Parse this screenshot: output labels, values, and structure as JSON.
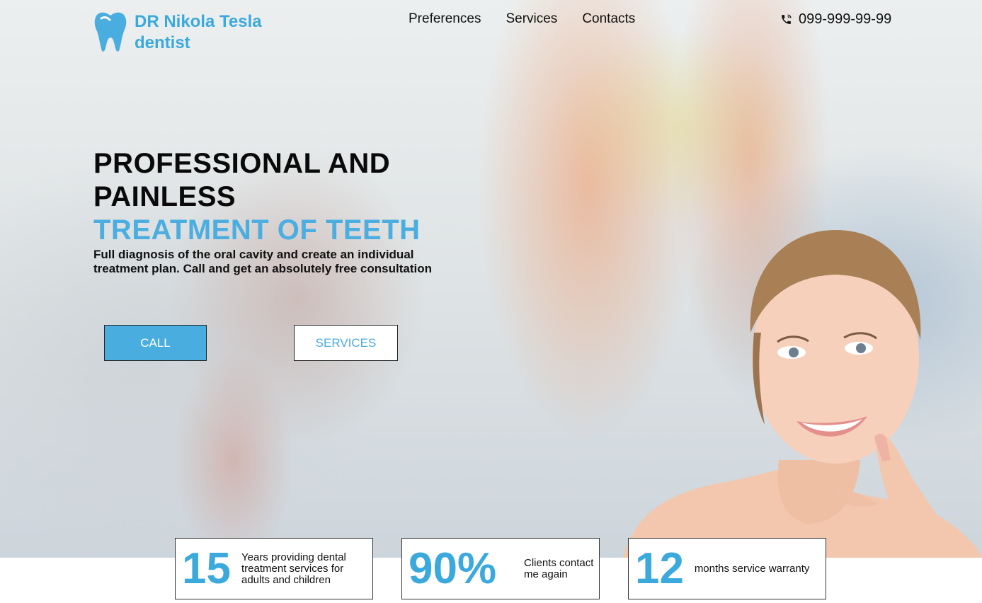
{
  "header": {
    "logo_line1": "DR Nikola Tesla",
    "logo_line2": "dentist",
    "nav": [
      "Preferences",
      "Services",
      "Contacts"
    ],
    "phone": "099-999-99-99"
  },
  "hero": {
    "headline": [
      "PROFESSIONAL AND",
      "PAINLESS"
    ],
    "headline_accent": "TREATMENT OF TEETH",
    "subtitle": "Full diagnosis of the oral cavity and create an individual treatment plan. Call and get an absolutely free consultation",
    "call_button": "CALL",
    "services_button": "SERVICES"
  },
  "stats": [
    {
      "number": "15",
      "text": "Years providing dental treatment services for adults and children"
    },
    {
      "number": "90%",
      "text": "Clients contact me again"
    },
    {
      "number": "12",
      "text": "months service warranty"
    }
  ],
  "colors": {
    "accent": "#3ca9dd",
    "text": "#111111",
    "background": "#ffffff"
  },
  "icons": {
    "logo": "tooth-icon",
    "phone": "phone-icon"
  }
}
